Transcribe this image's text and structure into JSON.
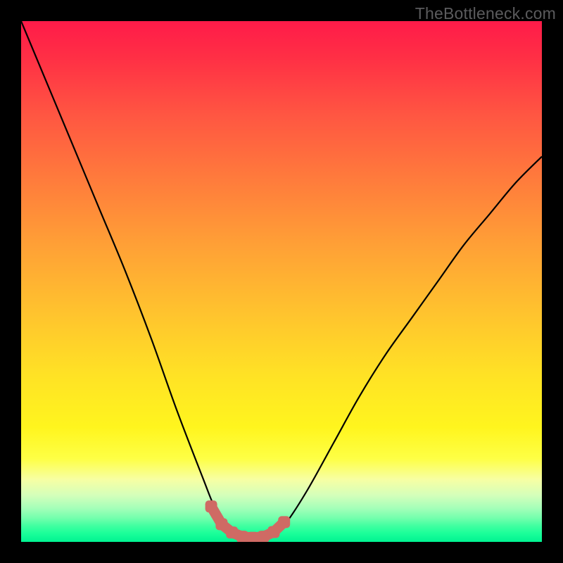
{
  "watermark": "TheBottleneck.com",
  "chart_data": {
    "type": "line",
    "title": "",
    "xlabel": "",
    "ylabel": "",
    "xlim": [
      0,
      100
    ],
    "ylim": [
      0,
      100
    ],
    "grid": false,
    "legend": false,
    "series": [
      {
        "name": "bottleneck-curve",
        "color": "#000000",
        "x": [
          0,
          5,
          10,
          15,
          20,
          25,
          30,
          35,
          37,
          39,
          41,
          43,
          45,
          47,
          49,
          51,
          55,
          60,
          65,
          70,
          75,
          80,
          85,
          90,
          95,
          100
        ],
        "y": [
          100,
          88,
          76,
          64,
          52,
          39,
          25,
          12,
          7,
          3.5,
          1.8,
          1.0,
          0.8,
          1.0,
          1.9,
          3.8,
          10,
          19,
          28,
          36,
          43,
          50,
          57,
          63,
          69,
          74
        ]
      }
    ],
    "optimal_band": {
      "color": "#cf6a64",
      "points_x": [
        36.5,
        38.5,
        40.5,
        42.5,
        44.5,
        46.5,
        48.5,
        50.5
      ],
      "points_y": [
        6.8,
        3.4,
        1.8,
        1.0,
        0.8,
        1.0,
        1.9,
        3.8
      ]
    },
    "gradient_zones": [
      {
        "label": "severe-bottleneck",
        "color": "#ff1b49",
        "y_start": 100,
        "y_end": 70
      },
      {
        "label": "moderate-bottleneck",
        "color": "#ffb030",
        "y_start": 70,
        "y_end": 25
      },
      {
        "label": "minor-bottleneck",
        "color": "#fff000",
        "y_start": 25,
        "y_end": 8
      },
      {
        "label": "near-balanced",
        "color": "#d0ffb0",
        "y_start": 8,
        "y_end": 3
      },
      {
        "label": "balanced",
        "color": "#00f090",
        "y_start": 3,
        "y_end": 0
      }
    ]
  }
}
